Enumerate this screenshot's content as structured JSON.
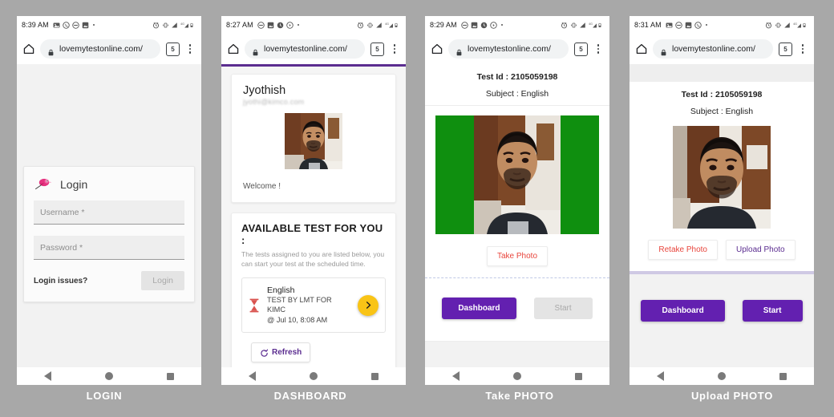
{
  "meta": {
    "background_color": "#a8a8a8",
    "accent_purple": "#6320b0",
    "accent_red": "#e8453c",
    "accent_yellow": "#f9c416",
    "camera_green": "#0f8f0f"
  },
  "captions": {
    "login": "LOGIN",
    "dashboard": "DASHBOARD",
    "take_photo": "Take PHOTO",
    "upload_photo": "Upload PHOTO"
  },
  "phones": [
    {
      "id": "login",
      "status": {
        "time": "8:39 AM",
        "left_icons": [
          "image-icon",
          "whatsapp-icon",
          "do-not-disturb-icon",
          "photo-icon"
        ],
        "right_icons": [
          "alarm-icon",
          "vibrate-icon",
          "signal-icon",
          "network-4g-icon",
          "battery-icon"
        ]
      },
      "browser": {
        "home": "home-icon",
        "lock": "lock-icon",
        "url": "lovemytestonline.com/",
        "tab_count": "5",
        "menu": "kebab-menu-icon"
      },
      "login_card": {
        "logo": "pink-bird-logo",
        "title": "Login",
        "username_placeholder": "Username *",
        "password_placeholder": "Password *",
        "issues_link": "Login issues?",
        "submit_label": "Login",
        "submit_disabled": true
      }
    },
    {
      "id": "dashboard",
      "status": {
        "time": "8:27 AM",
        "left_icons": [
          "do-not-disturb-icon",
          "photo-icon",
          "clock-icon",
          "sound-icon"
        ],
        "right_icons": [
          "alarm-icon",
          "vibrate-icon",
          "signal-icon",
          "network-4g-icon",
          "battery-icon"
        ]
      },
      "browser": {
        "home": "home-icon",
        "lock": "lock-icon",
        "url": "lovemytestonline.com/",
        "tab_count": "5",
        "menu": "kebab-menu-icon"
      },
      "profile": {
        "name": "Jyothish",
        "email": "jyothi@kimco.com",
        "avatar": "user-photo",
        "welcome": "Welcome !"
      },
      "tests": {
        "heading": "AVAILABLE TEST FOR YOU :",
        "subtitle": "The tests assigned to you are listed below, you can start your test at the scheduled time.",
        "items": [
          {
            "icon": "hourglass-icon",
            "subject": "English",
            "name": "TEST BY LMT FOR KIMC",
            "schedule": "@ Jul 10, 8:08 AM",
            "go": "chevron-right-icon"
          }
        ],
        "refresh_label": "Refresh"
      }
    },
    {
      "id": "take-photo",
      "status": {
        "time": "8:29 AM",
        "left_icons": [
          "do-not-disturb-icon",
          "photo-icon",
          "clock-icon",
          "sound-icon"
        ],
        "right_icons": [
          "alarm-icon",
          "vibrate-icon",
          "signal-icon",
          "network-4g-icon",
          "battery-icon"
        ]
      },
      "browser": {
        "home": "home-icon",
        "lock": "lock-icon",
        "url": "lovemytestonline.com/",
        "tab_count": "5",
        "menu": "kebab-menu-icon"
      },
      "test_info": {
        "test_id": "Test Id : 2105059198",
        "subject": "Subject : English"
      },
      "camera": {
        "preview": "live-camera-preview",
        "capture_label": "Take Photo"
      },
      "actions": {
        "dashboard_label": "Dashboard",
        "start_label": "Start",
        "start_disabled": true
      }
    },
    {
      "id": "upload-photo",
      "status": {
        "time": "8:31 AM",
        "left_icons": [
          "image-icon",
          "do-not-disturb-icon",
          "photo-icon",
          "whatsapp-icon"
        ],
        "right_icons": [
          "alarm-icon",
          "vibrate-icon",
          "signal-icon",
          "network-4g-icon",
          "battery-icon"
        ]
      },
      "browser": {
        "home": "home-icon",
        "lock": "lock-icon",
        "url": "lovemytestonline.com/",
        "tab_count": "5",
        "menu": "kebab-menu-icon"
      },
      "test_info": {
        "test_id": "Test Id : 2105059198",
        "subject": "Subject : English"
      },
      "photo": {
        "preview": "captured-photo",
        "retake_label": "Retake Photo",
        "upload_label": "Upload Photo"
      },
      "actions": {
        "dashboard_label": "Dashboard",
        "start_label": "Start",
        "start_disabled": false
      }
    }
  ]
}
